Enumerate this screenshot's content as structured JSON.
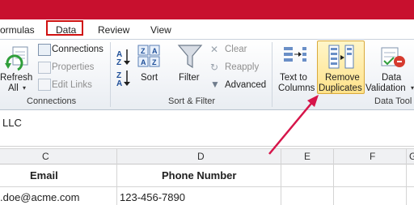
{
  "tabs": [
    {
      "label": "ormulas"
    },
    {
      "label": "Data"
    },
    {
      "label": "Review"
    },
    {
      "label": "View"
    }
  ],
  "ribbon": {
    "connections": {
      "refresh_label_1": "Refresh",
      "refresh_label_2": "All",
      "connections_label": "Connections",
      "properties_label": "Properties",
      "edit_links_label": "Edit Links",
      "group_label": "Connections"
    },
    "sort_filter": {
      "sort_label": "Sort",
      "filter_label": "Filter",
      "clear_label": "Clear",
      "reapply_label": "Reapply",
      "advanced_label": "Advanced",
      "group_label": "Sort & Filter"
    },
    "data_tools": {
      "text_to_columns_1": "Text to",
      "text_to_columns_2": "Columns",
      "remove_duplicates_1": "Remove",
      "remove_duplicates_2": "Duplicates",
      "data_validation_1": "Data",
      "data_validation_2": "Validation",
      "group_label": "Data Tool"
    }
  },
  "formula_area": {
    "cell_text": "LLC"
  },
  "grid": {
    "columns": [
      "C",
      "D",
      "E",
      "F",
      "G"
    ],
    "header_row": {
      "email": "Email",
      "phone": "Phone Number"
    },
    "row1": {
      "email": ".doe@acme.com",
      "phone": "123-456-7890"
    }
  },
  "colors": {
    "title_bar": "#c8102e",
    "highlight": "#d01010",
    "selected_button": "#ffe28a"
  }
}
